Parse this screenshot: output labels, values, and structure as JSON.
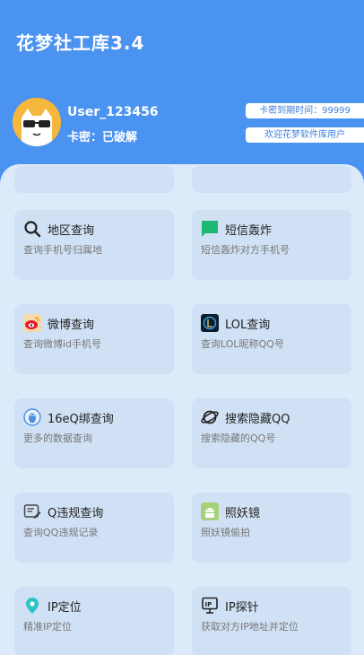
{
  "app": {
    "title": "花梦社工库3.4"
  },
  "user": {
    "name": "User_123456",
    "card_status": "卡密：已破解",
    "avatar_icon": "cat-with-sunglasses"
  },
  "pills": {
    "expiry": "卡密到期时间：99999",
    "welcome": "欢迎花梦软件库用户"
  },
  "tools": [
    {
      "title": "地区查询",
      "desc": "查询手机号归属地",
      "icon": "search-icon"
    },
    {
      "title": "短信轰炸",
      "desc": "短信轰炸对方手机号",
      "icon": "message-icon"
    },
    {
      "title": "微博查询",
      "desc": "查询微博id手机号",
      "icon": "weibo-icon"
    },
    {
      "title": "LOL查询",
      "desc": "查询LOL昵称QQ号",
      "icon": "lol-icon"
    },
    {
      "title": "16eQ绑查询",
      "desc": "更多的数据查询",
      "icon": "qq-penguin-icon"
    },
    {
      "title": "搜索隐藏QQ",
      "desc": "搜索隐藏的QQ号",
      "icon": "planet-icon"
    },
    {
      "title": "Q违规查询",
      "desc": "查询QQ违规记录",
      "icon": "document-edit-icon"
    },
    {
      "title": "照妖镜",
      "desc": "照妖镜偷拍",
      "icon": "android-icon"
    },
    {
      "title": "IP定位",
      "desc": "精准IP定位",
      "icon": "location-pin-icon"
    },
    {
      "title": "IP探针",
      "desc": "获取对方IP地址并定位",
      "icon": "ip-probe-icon"
    }
  ]
}
